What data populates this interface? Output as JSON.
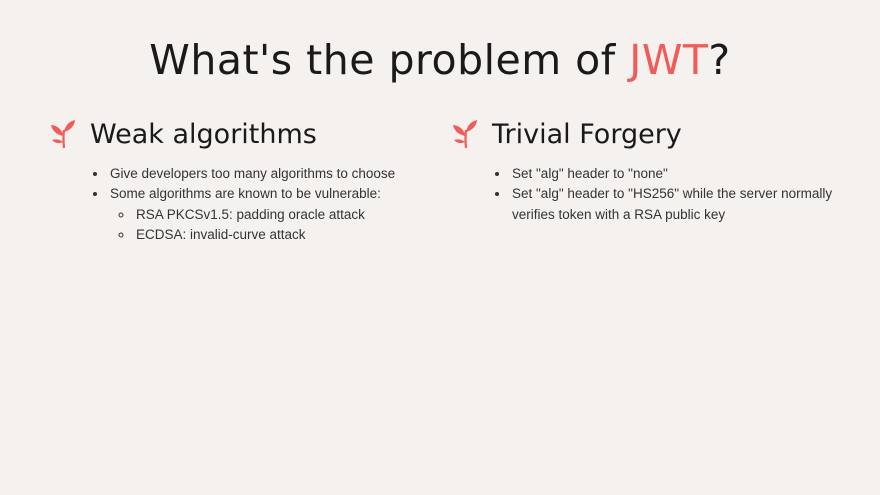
{
  "title": {
    "prefix": "What's the problem of ",
    "accent": "JWT",
    "suffix": "?"
  },
  "accent_color": "#f25b57",
  "columns": [
    {
      "heading": "Weak algorithms",
      "icon": "sprout-icon",
      "bullets": [
        "Give developers too many algorithms to choose",
        "Some algorithms are known to be vulnerable:"
      ],
      "sub_bullets": [
        "RSA PKCSv1.5: padding oracle attack",
        "ECDSA: invalid-curve attack"
      ]
    },
    {
      "heading": "Trivial Forgery",
      "icon": "sprout-icon",
      "bullets": [
        "Set \"alg\" header to \"none\"",
        "Set \"alg\" header to \"HS256\" while the server normally verifies token with a RSA public key"
      ]
    }
  ]
}
